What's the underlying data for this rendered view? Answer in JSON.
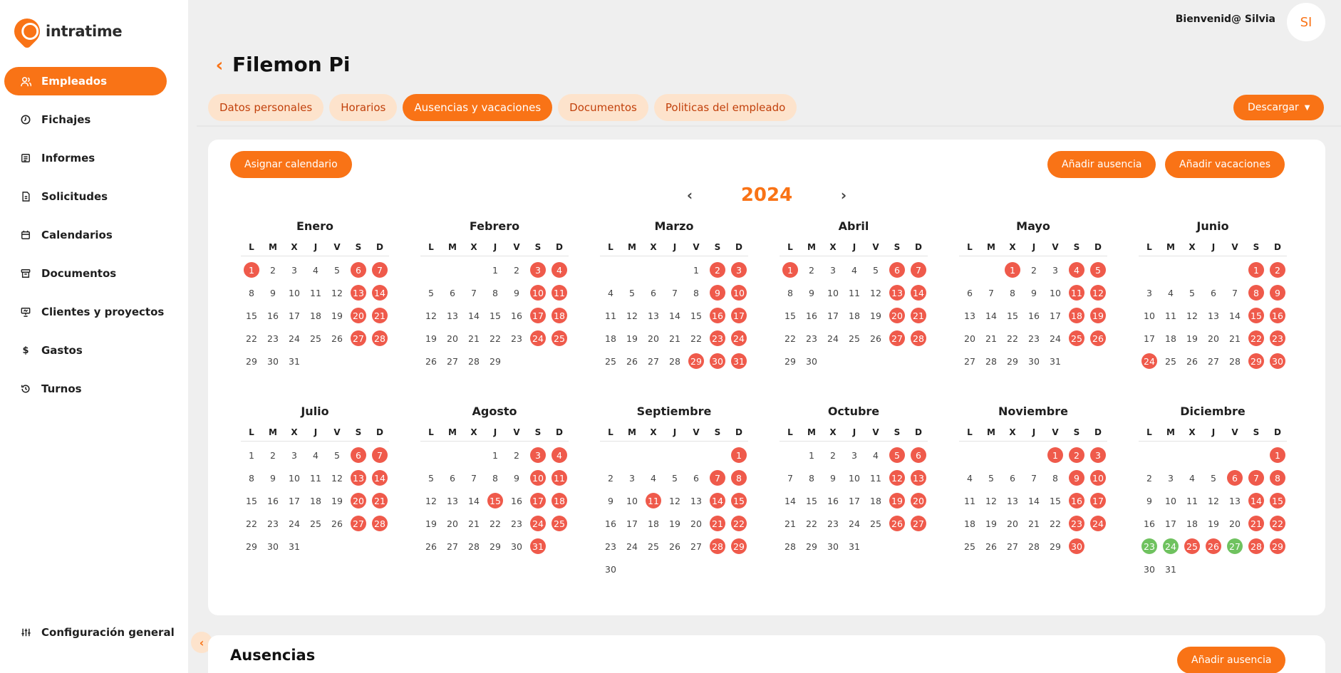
{
  "app": {
    "name": "intratime"
  },
  "sidebar": {
    "items": [
      {
        "label": "Empleados",
        "icon": "users-icon",
        "active": true
      },
      {
        "label": "Fichajes",
        "icon": "clock-icon"
      },
      {
        "label": "Informes",
        "icon": "report-icon"
      },
      {
        "label": "Solicitudes",
        "icon": "file-icon"
      },
      {
        "label": "Calendarios",
        "icon": "calendar-icon"
      },
      {
        "label": "Documentos",
        "icon": "archive-icon"
      },
      {
        "label": "Clientes y proyectos",
        "icon": "presentation-icon"
      },
      {
        "label": "Gastos",
        "icon": "dollar-icon"
      },
      {
        "label": "Turnos",
        "icon": "history-icon"
      }
    ],
    "bottom": {
      "label": "Configuración general",
      "icon": "sliders-icon"
    }
  },
  "header": {
    "welcome": "Bienvenid@ Silvia",
    "avatar_initials": "SI"
  },
  "page": {
    "title": "Filemon Pi"
  },
  "tabs": [
    {
      "label": "Datos personales"
    },
    {
      "label": "Horarios"
    },
    {
      "label": "Ausencias y vacaciones",
      "active": true
    },
    {
      "label": "Documentos"
    },
    {
      "label": "Politicas del empleado"
    }
  ],
  "download": {
    "label": "Descargar"
  },
  "calendar": {
    "assign_label": "Asignar calendario",
    "add_absence_label": "Añadir ausencia",
    "add_vacation_label": "Añadir vacaciones",
    "year": "2024",
    "weekdays": [
      "L",
      "M",
      "X",
      "J",
      "V",
      "S",
      "D"
    ],
    "months": [
      {
        "name": "Enero",
        "offset": 0,
        "days": 31,
        "off": [
          1,
          6,
          7,
          13,
          14,
          20,
          21,
          27,
          28
        ],
        "vac": []
      },
      {
        "name": "Febrero",
        "offset": 3,
        "days": 29,
        "off": [
          3,
          4,
          10,
          11,
          17,
          18,
          24,
          25
        ],
        "vac": []
      },
      {
        "name": "Marzo",
        "offset": 4,
        "days": 31,
        "off": [
          2,
          3,
          9,
          10,
          16,
          17,
          23,
          24,
          29,
          30,
          31
        ],
        "vac": []
      },
      {
        "name": "Abril",
        "offset": 0,
        "days": 30,
        "off": [
          1,
          6,
          7,
          13,
          14,
          20,
          21,
          27,
          28
        ],
        "vac": []
      },
      {
        "name": "Mayo",
        "offset": 2,
        "days": 31,
        "off": [
          1,
          4,
          5,
          11,
          12,
          18,
          19,
          25,
          26
        ],
        "vac": []
      },
      {
        "name": "Junio",
        "offset": 5,
        "days": 30,
        "off": [
          1,
          2,
          8,
          9,
          15,
          16,
          22,
          23,
          24,
          29,
          30
        ],
        "vac": []
      },
      {
        "name": "Julio",
        "offset": 0,
        "days": 31,
        "off": [
          6,
          7,
          13,
          14,
          20,
          21,
          27,
          28
        ],
        "vac": []
      },
      {
        "name": "Agosto",
        "offset": 3,
        "days": 31,
        "off": [
          3,
          4,
          10,
          11,
          15,
          17,
          18,
          24,
          25,
          31
        ],
        "vac": []
      },
      {
        "name": "Septiembre",
        "offset": 6,
        "days": 30,
        "off": [
          1,
          7,
          8,
          11,
          14,
          15,
          21,
          22,
          28,
          29
        ],
        "vac": []
      },
      {
        "name": "Octubre",
        "offset": 1,
        "days": 31,
        "off": [
          5,
          6,
          12,
          13,
          19,
          20,
          26,
          27
        ],
        "vac": []
      },
      {
        "name": "Noviembre",
        "offset": 4,
        "days": 30,
        "off": [
          1,
          2,
          3,
          9,
          10,
          16,
          17,
          23,
          24,
          30
        ],
        "vac": []
      },
      {
        "name": "Diciembre",
        "offset": 6,
        "days": 31,
        "off": [
          1,
          6,
          7,
          8,
          14,
          15,
          21,
          22,
          25,
          26,
          28,
          29
        ],
        "vac": [
          23,
          24,
          27
        ]
      }
    ]
  },
  "absences": {
    "title": "Ausencias",
    "add_label": "Añadir ausencia"
  },
  "colors": {
    "accent": "#f97316",
    "accent_soft": "#fde3cc",
    "holiday": "#ef5a4b",
    "vacation": "#6fc25f"
  }
}
